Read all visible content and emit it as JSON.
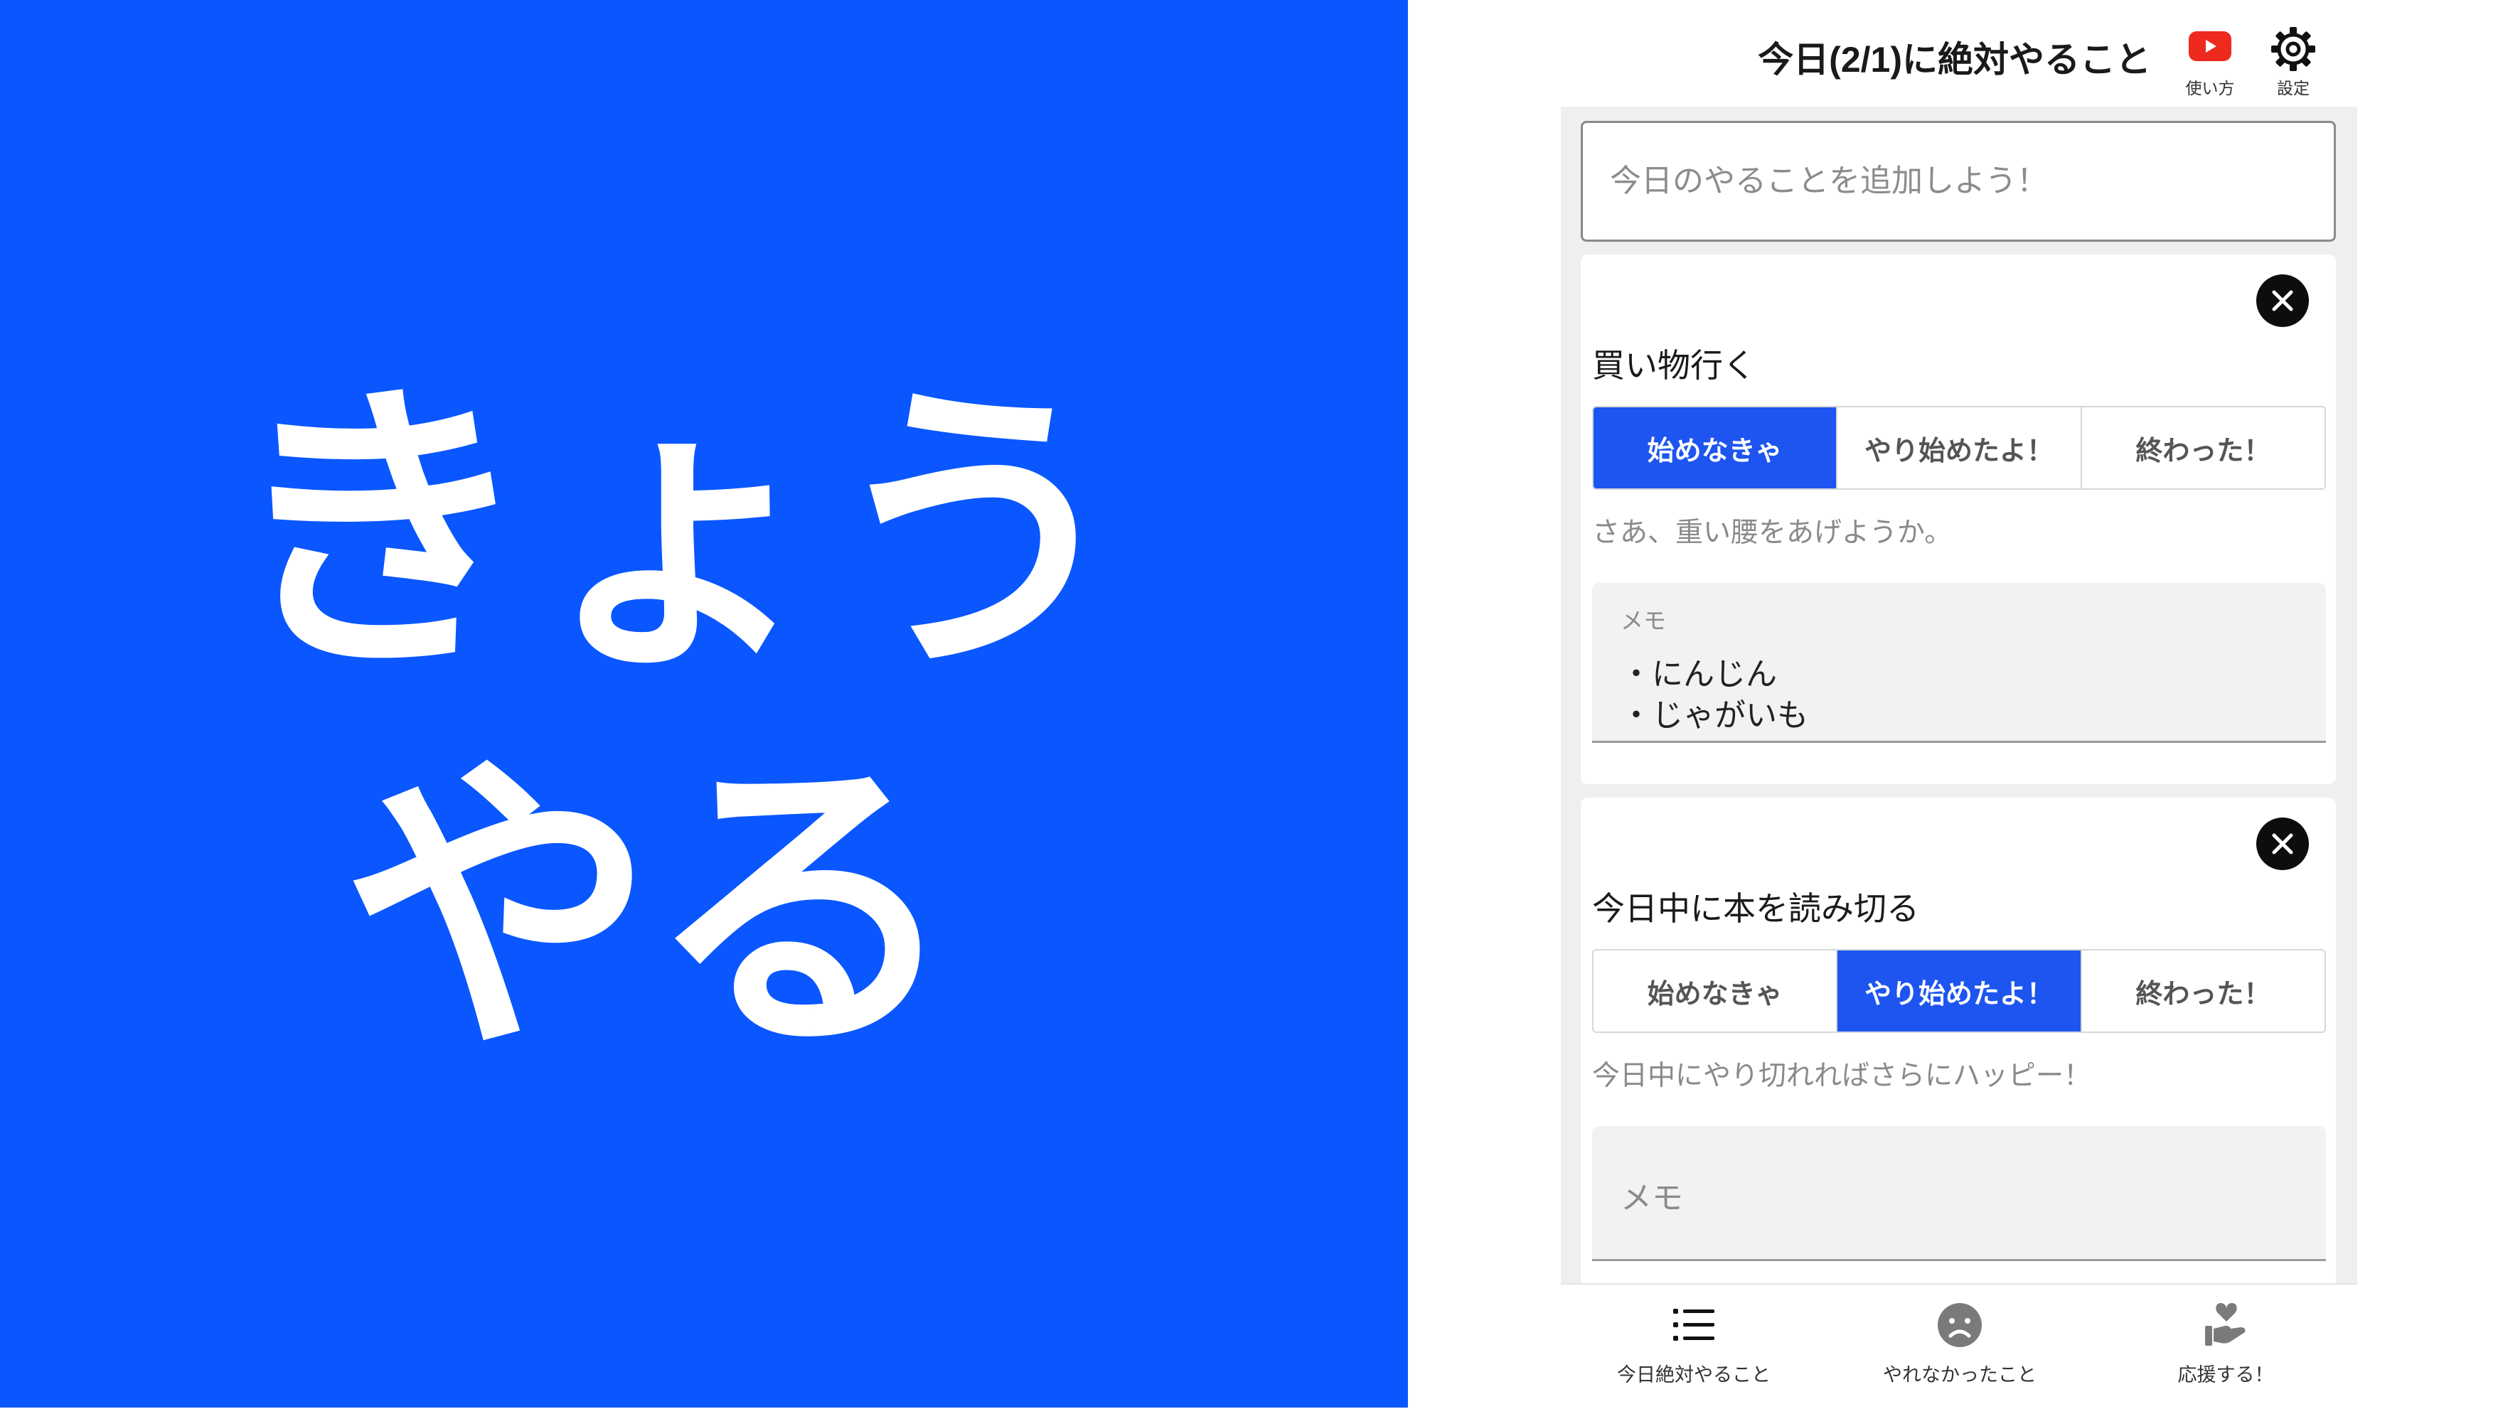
{
  "brand": {
    "line1": "きょう",
    "line2": "やる",
    "background": "#0a57ff"
  },
  "header": {
    "title": "今日(2/1)に絶対やること",
    "howto_label": "使い方",
    "howto_icon": "youtube-icon",
    "settings_label": "設定",
    "settings_icon": "gear-icon"
  },
  "add_task": {
    "placeholder": "今日のやることを追加しよう！",
    "value": ""
  },
  "status_options": [
    "始めなきゃ",
    "やり始めたよ！",
    "終わった！"
  ],
  "accent_color": "#1e55f0",
  "tasks": [
    {
      "title": "買い物行く",
      "status_index": 0,
      "hint": "さあ、重い腰をあげようか。",
      "memo_label": "メモ",
      "memo_lines": [
        "・にんじん",
        "・じゃがいも"
      ]
    },
    {
      "title": "今日中に本を読み切る",
      "status_index": 1,
      "hint": "今日中にやり切れればさらにハッピー！",
      "memo_placeholder": "メモ",
      "memo_lines": []
    }
  ],
  "bottom_nav": [
    {
      "label": "今日絶対やること",
      "icon": "list-icon"
    },
    {
      "label": "やれなかったこと",
      "icon": "sad-face-icon"
    },
    {
      "label": "応援する！",
      "icon": "heart-hand-icon"
    }
  ]
}
